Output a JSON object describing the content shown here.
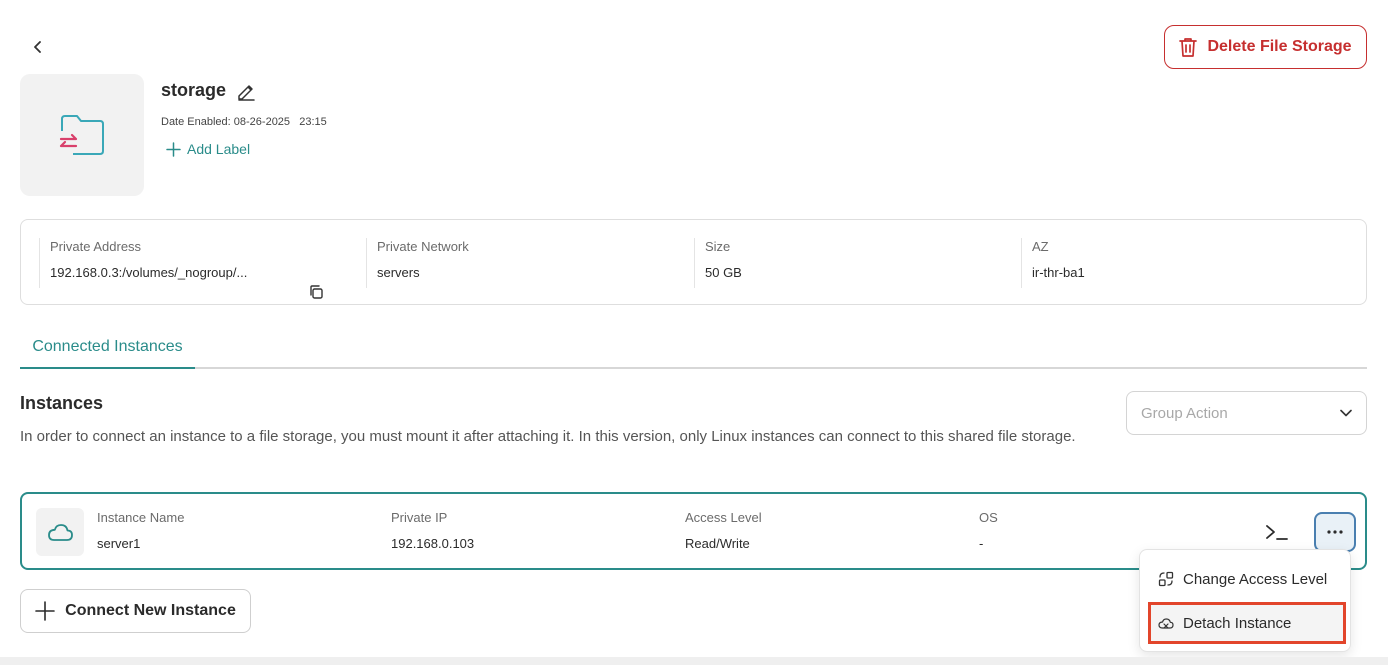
{
  "header": {
    "back_icon": "chevron-left-icon",
    "delete_button_label": "Delete File Storage",
    "delete_icon": "trash-icon",
    "accent_red": "#c62f2f"
  },
  "storage": {
    "icon": "folder-transfer-icon",
    "name": "storage",
    "edit_icon": "pencil-icon",
    "date_enabled": "Date Enabled: 08-26-2025   23:15",
    "add_label": "Add Label"
  },
  "info": {
    "private_address_label": "Private Address",
    "private_address_value": "192.168.0.3:/volumes/_nogroup/...",
    "copy_icon": "copy-icon",
    "private_network_label": "Private Network",
    "private_network_value": "servers",
    "size_label": "Size",
    "size_value": "50 GB",
    "az_label": "AZ",
    "az_value": "ir-thr-ba1"
  },
  "tabs": {
    "active": "Connected Instances",
    "accent": "#2a8c8a"
  },
  "instances_section": {
    "title": "Instances",
    "description": "In order to connect an instance to a file storage, you must mount it after attaching it. In this version, only Linux instances can connect to this shared file storage.",
    "group_action_placeholder": "Group Action",
    "connect_button_label": "Connect New Instance"
  },
  "instances": [
    {
      "icon": "cloud-icon",
      "name_label": "Instance Name",
      "name": "server1",
      "ip_label": "Private IP",
      "ip": "192.168.0.103",
      "access_label": "Access Level",
      "access": "Read/Write",
      "os_label": "OS",
      "os": "-"
    }
  ],
  "instance_menu": {
    "items": [
      {
        "label": "Change Access Level",
        "icon": "access-level-icon"
      },
      {
        "label": "Detach Instance",
        "icon": "detach-cloud-icon"
      }
    ]
  }
}
